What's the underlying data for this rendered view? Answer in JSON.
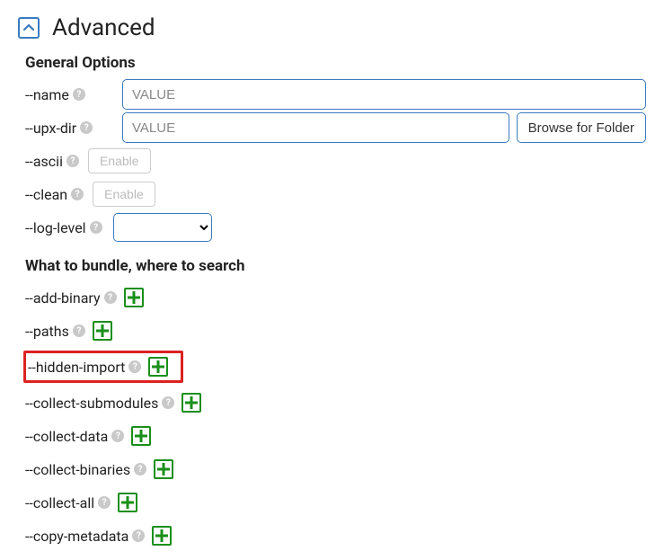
{
  "header": {
    "title": "Advanced"
  },
  "sections": {
    "general": {
      "title": "General Options",
      "name": {
        "label": "--name",
        "placeholder": "VALUE"
      },
      "upxdir": {
        "label": "--upx-dir",
        "placeholder": "VALUE",
        "browse": "Browse for Folder"
      },
      "ascii": {
        "label": "--ascii",
        "enable": "Enable"
      },
      "clean": {
        "label": "--clean",
        "enable": "Enable"
      },
      "loglevel": {
        "label": "--log-level"
      }
    },
    "bundle": {
      "title": "What to bundle, where to search",
      "add_binary": {
        "label": "--add-binary"
      },
      "paths": {
        "label": "--paths"
      },
      "hidden_import": {
        "label": "--hidden-import"
      },
      "collect_submodules": {
        "label": "--collect-submodules"
      },
      "collect_data": {
        "label": "--collect-data"
      },
      "collect_binaries": {
        "label": "--collect-binaries"
      },
      "collect_all": {
        "label": "--collect-all"
      },
      "copy_metadata": {
        "label": "--copy-metadata"
      }
    }
  }
}
